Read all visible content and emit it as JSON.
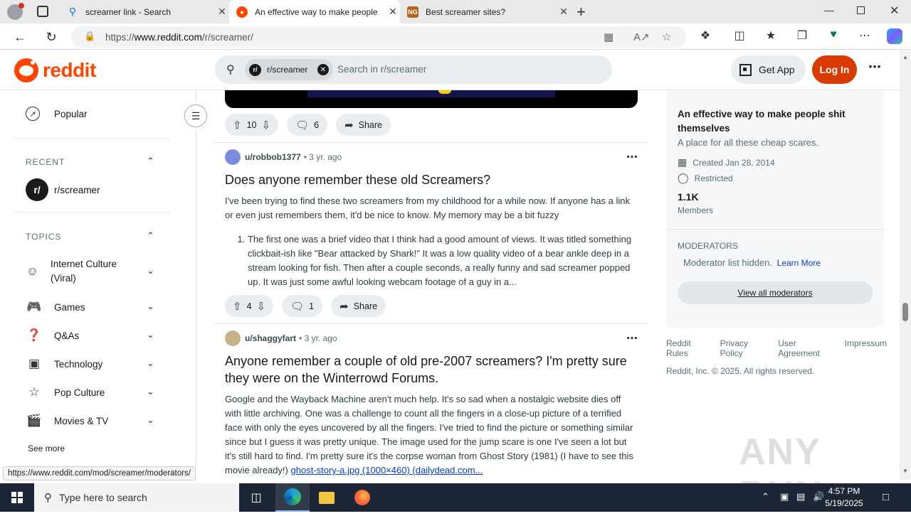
{
  "browser": {
    "tabs": [
      {
        "title": "screamer link - Search",
        "favicon": "search-icon"
      },
      {
        "title": "An effective way to make people",
        "favicon": "reddit-icon"
      },
      {
        "title": "Best screamer sites?",
        "favicon": "site-icon"
      }
    ],
    "url_prefix": "https://",
    "url_host": "www.reddit.com",
    "url_path": "/r/screamer/"
  },
  "header": {
    "logo_text": "reddit",
    "search_chip": "r/screamer",
    "search_placeholder": "Search in r/screamer",
    "get_app": "Get App",
    "login": "Log In"
  },
  "sidebar": {
    "popular": "Popular",
    "recent_heading": "RECENT",
    "recent_item": "r/screamer",
    "topics_heading": "TOPICS",
    "topics": [
      {
        "label": "Internet Culture (Viral)",
        "icon": "smile-icon"
      },
      {
        "label": "Games",
        "icon": "gamepad-icon"
      },
      {
        "label": "Q&As",
        "icon": "question-icon"
      },
      {
        "label": "Technology",
        "icon": "chip-icon"
      },
      {
        "label": "Pop Culture",
        "icon": "star-icon"
      },
      {
        "label": "Movies & TV",
        "icon": "clapper-icon"
      }
    ],
    "see_more": "See more"
  },
  "feed": {
    "prev_post": {
      "votes": "10",
      "comments": "6",
      "share": "Share"
    },
    "post1": {
      "user": "u/robbob1377",
      "time": "3 yr. ago",
      "title": "Does anyone remember these old Screamers?",
      "body": "I've been trying to find these two screamers from my childhood for a while now. If anyone has a link or even just remembers them, it'd be nice to know. My memory may be a bit fuzzy",
      "list_item": "The first one was a brief video that I think had a good amount of views. It was titled something clickbait-ish like \"Bear attacked by Shark!\" It was a low quality video of a bear ankle deep in a stream looking for fish. Then after a couple seconds, a really funny and sad screamer popped up. It was just some awful looking webcam footage of a guy in a...",
      "votes": "4",
      "comments": "1",
      "share": "Share"
    },
    "post2": {
      "user": "u/shaggyfart",
      "time": "3 yr. ago",
      "title": "Anyone remember a couple of old pre-2007 screamers? I'm pretty sure they were on the Winterrowd Forums.",
      "body": "Google and the Wayback Machine aren't much help. It's so sad when a nostalgic website dies off with little archiving. One was a challenge to count all the fingers in a close-up picture of a terrified face with only the eyes uncovered by all the fingers. I've tried to find the picture or something similar since but I guess it was pretty unique. The image used for the jump scare is one I've seen a lot but it's still hard to find. I'm pretty sure it's the corpse woman from Ghost Story (1981) (I have to see this movie already!)",
      "link": "ghost-story-a.jpg (1000×460) (dailydead.com..."
    }
  },
  "about": {
    "title": "An effective way to make people shit themselves",
    "description": "A place for all these cheap scares.",
    "created": "Created Jan 28, 2014",
    "restricted": "Restricted",
    "members_count": "1.1K",
    "members_label": "Members",
    "moderators_heading": "MODERATORS",
    "mod_hidden": "Moderator list hidden.",
    "learn_more": "Learn More",
    "view_all": "View all moderators"
  },
  "footer": {
    "links": [
      "Reddit Rules",
      "Privacy Policy",
      "User Agreement",
      "Impressum"
    ],
    "copyright": "Reddit, Inc. © 2025. All rights reserved."
  },
  "status_url": "https://www.reddit.com/mod/screamer/moderators/",
  "watermark": "ANY RUN",
  "taskbar": {
    "search_placeholder": "Type here to search",
    "time": "4:57 PM",
    "date": "5/19/2025"
  },
  "colors": {
    "reddit_orange": "#ff4500",
    "login_button": "#d93a00",
    "link_blue": "#0a3ad1",
    "taskbar": "#1c2634"
  }
}
